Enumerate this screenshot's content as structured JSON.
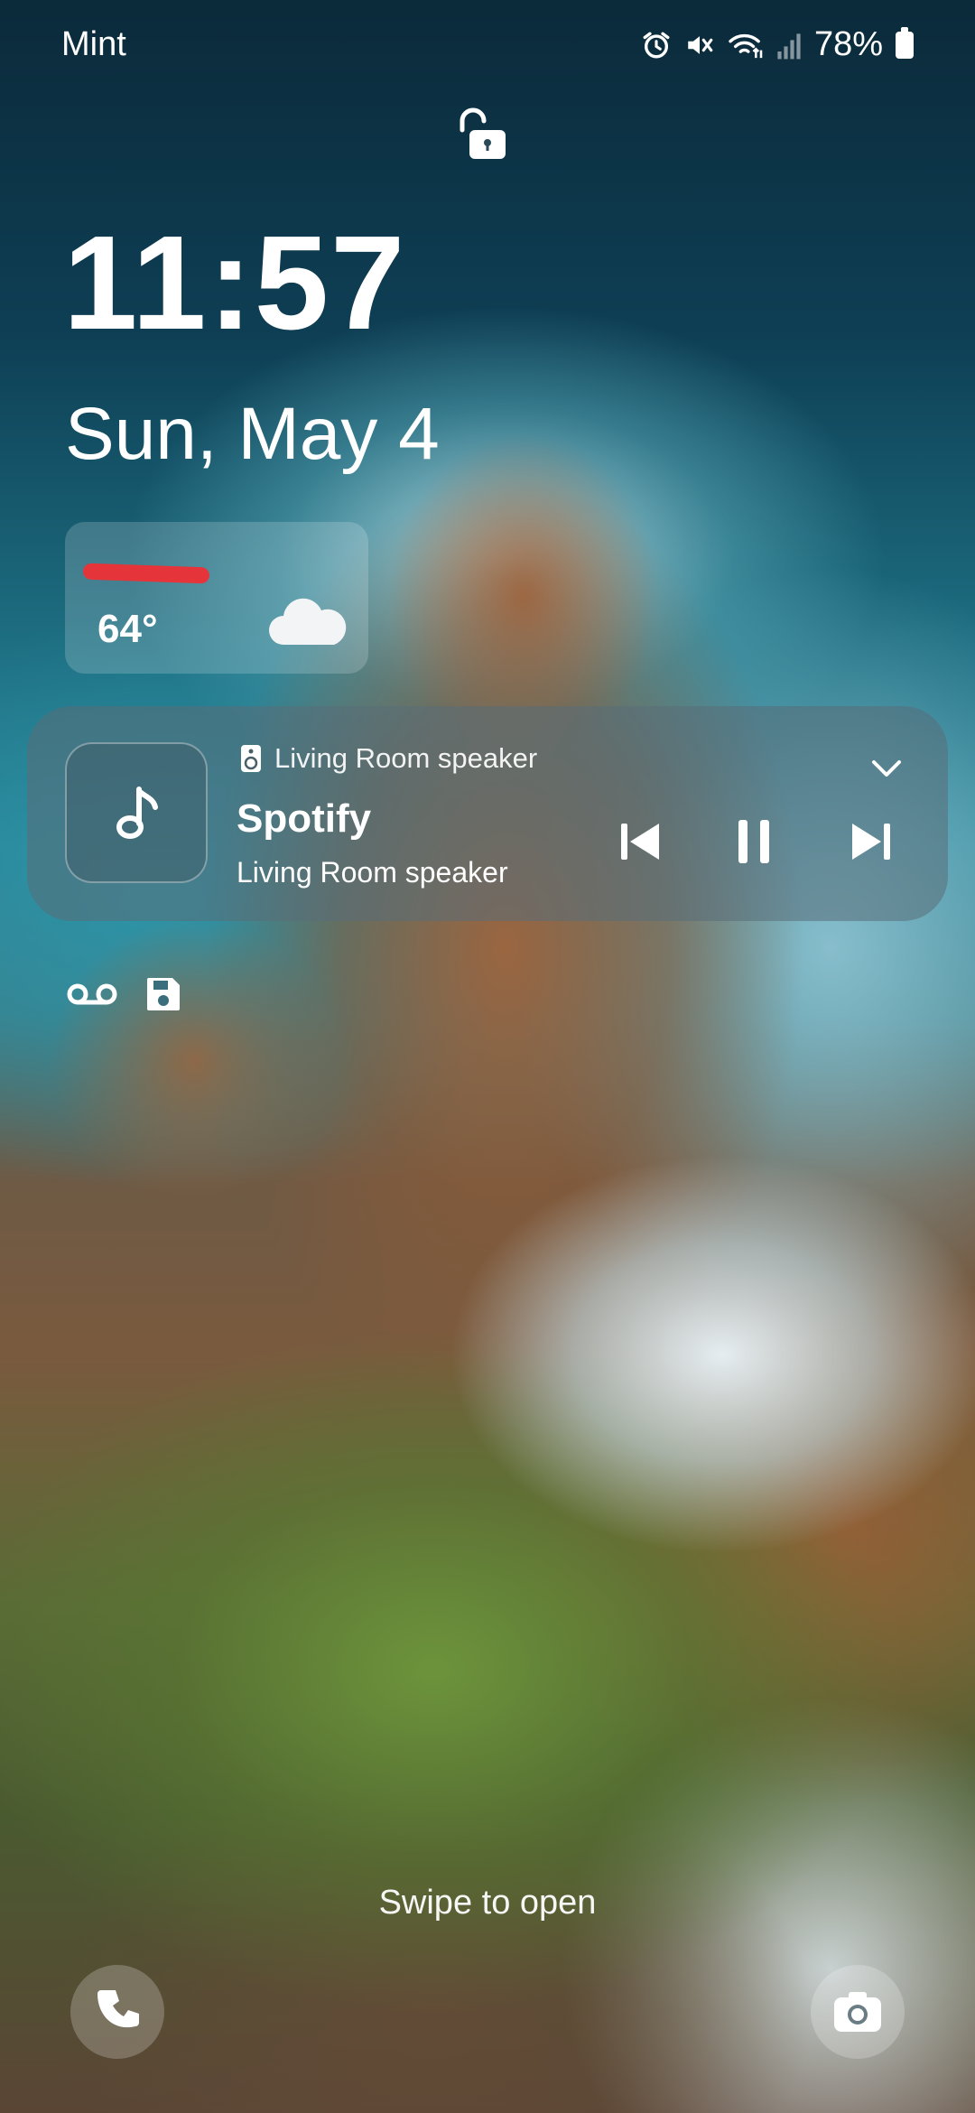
{
  "status_bar": {
    "carrier": "Mint",
    "battery": "78%",
    "icons": [
      "alarm-icon",
      "mute-icon",
      "wifi-icon",
      "signal-icon",
      "battery-icon"
    ]
  },
  "lock": {
    "icon": "unlocked-padlock-icon"
  },
  "clock": {
    "time": "11:57",
    "date": "Sun, May 4"
  },
  "weather": {
    "temperature": "64°",
    "condition_icon": "cloud-icon"
  },
  "media": {
    "device": "Living Room speaker",
    "title": "Spotify",
    "subtitle": "Living Room speaker",
    "controls": [
      "previous-track-icon",
      "pause-icon",
      "next-track-icon"
    ]
  },
  "notification_icons": [
    "voicemail-icon",
    "save-icon"
  ],
  "lockscreen": {
    "swipe_hint": "Swipe to open",
    "shortcuts": [
      "phone-icon",
      "camera-icon"
    ]
  }
}
